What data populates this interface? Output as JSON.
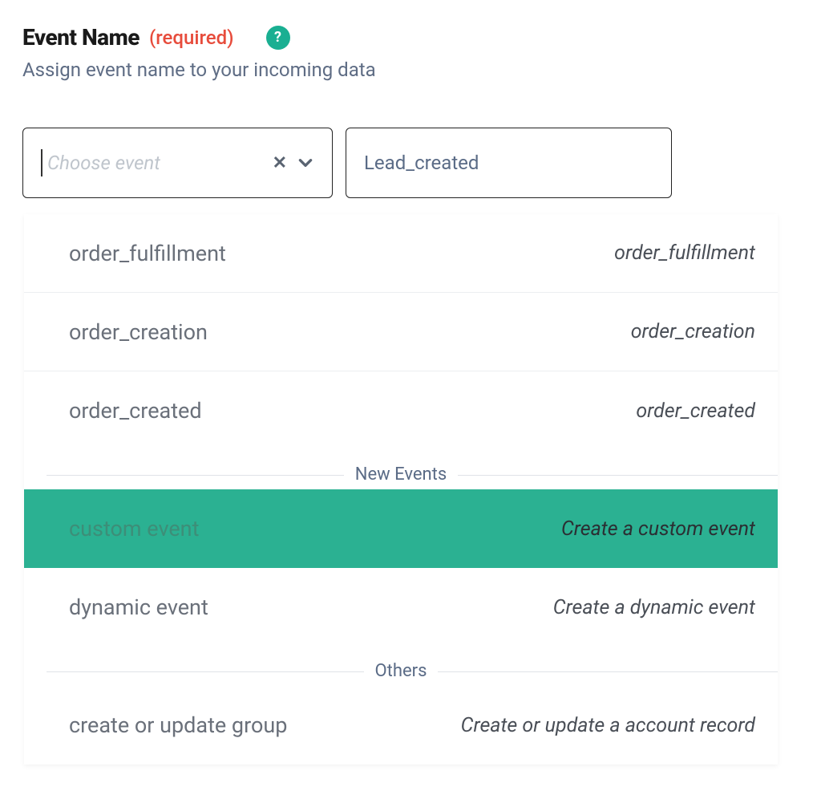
{
  "field": {
    "label": "Event Name",
    "required_text": "(required)",
    "help_icon": "?",
    "subtitle": "Assign event name to your incoming data"
  },
  "select": {
    "placeholder": "Choose event",
    "value": "Lead_created"
  },
  "dropdown": {
    "top": [
      {
        "label": "order_fulfillment",
        "desc": "order_fulfillment"
      },
      {
        "label": "order_creation",
        "desc": "order_creation"
      },
      {
        "label": "order_created",
        "desc": "order_created"
      }
    ],
    "groups": [
      {
        "title": "New Events",
        "items": [
          {
            "label": "custom event",
            "desc": "Create a custom event",
            "selected": true
          },
          {
            "label": "dynamic event",
            "desc": "Create a dynamic event"
          }
        ]
      },
      {
        "title": "Others",
        "items": [
          {
            "label": "create or update group",
            "desc": "Create or update a account record"
          }
        ]
      }
    ]
  }
}
